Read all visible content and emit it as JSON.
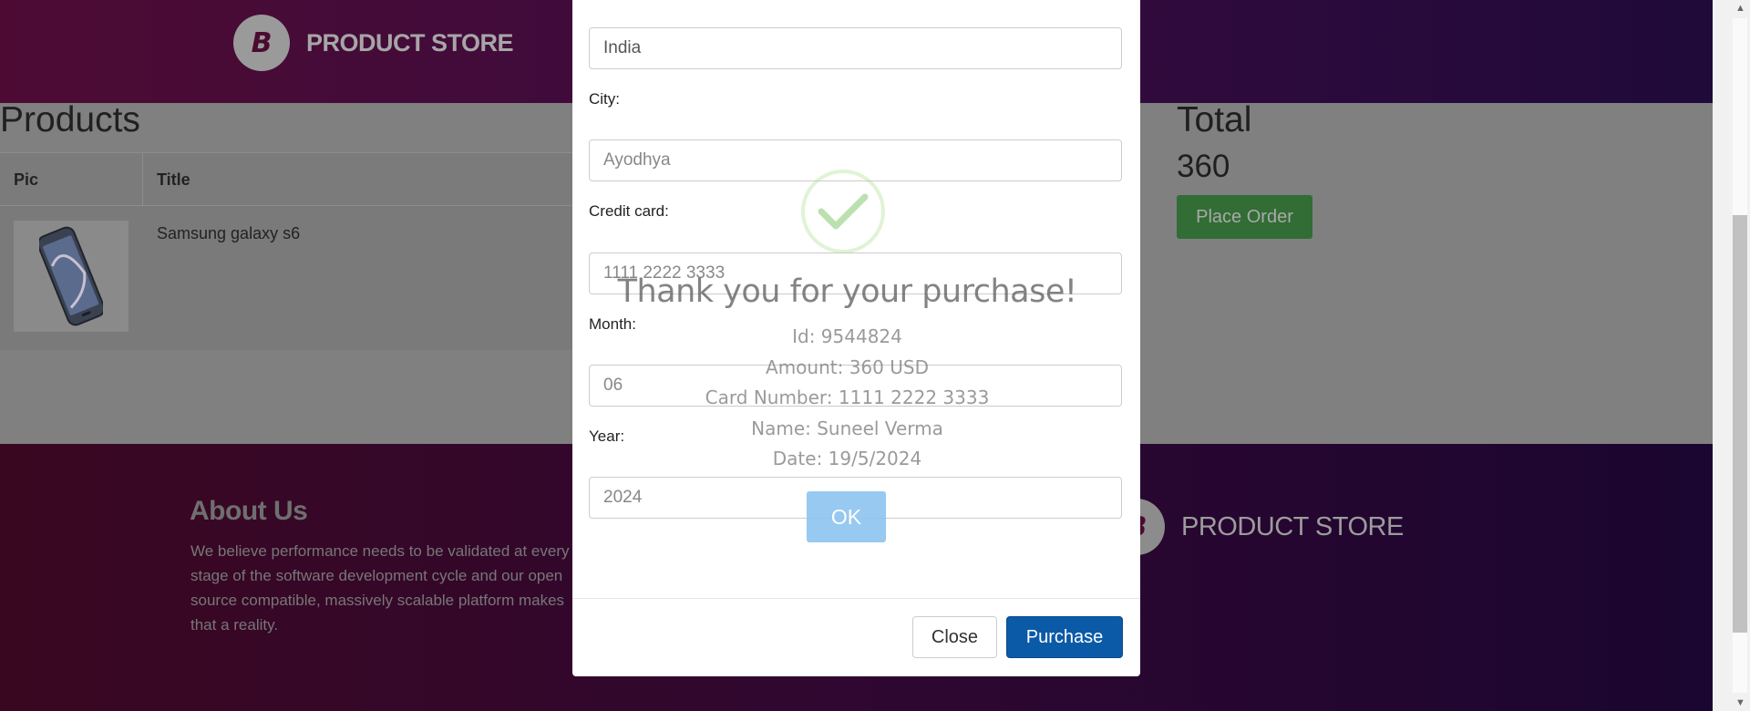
{
  "header": {
    "brand_name": "PRODUCT STORE",
    "logo_letter": "B"
  },
  "cart": {
    "title": "Products",
    "columns": [
      "Pic",
      "Title"
    ],
    "rows": [
      {
        "title": "Samsung galaxy s6"
      }
    ],
    "total_label": "Total",
    "total_value": "360",
    "place_order_label": "Place Order"
  },
  "footer": {
    "about_title": "About Us",
    "about_text": "We believe performance needs to be validated at every stage of the software development cycle and our open source compatible, massively scalable platform makes that a reality.",
    "brand_name": "PRODUCT STORE"
  },
  "order_modal": {
    "country_value": "India",
    "city_label": "City:",
    "city_value": "Ayodhya",
    "card_label": "Credit card:",
    "card_value": "1111 2222 3333",
    "month_label": "Month:",
    "month_value": "06",
    "year_label": "Year:",
    "year_value": "2024",
    "close_label": "Close",
    "purchase_label": "Purchase"
  },
  "purchase_alert": {
    "title": "Thank you for your purchase!",
    "id_line": "Id: 9544824",
    "amount_line": "Amount: 360 USD",
    "card_line": "Card Number: 1111 2222 3333",
    "name_line": "Name: Suneel Verma",
    "date_line": "Date: 19/5/2024",
    "ok_label": "OK"
  },
  "colors": {
    "brand_purple": "#5f0f40",
    "success_green": "#a5dc86",
    "purchase_blue": "#0b5aa8",
    "ok_blue": "#8cd4f5"
  }
}
